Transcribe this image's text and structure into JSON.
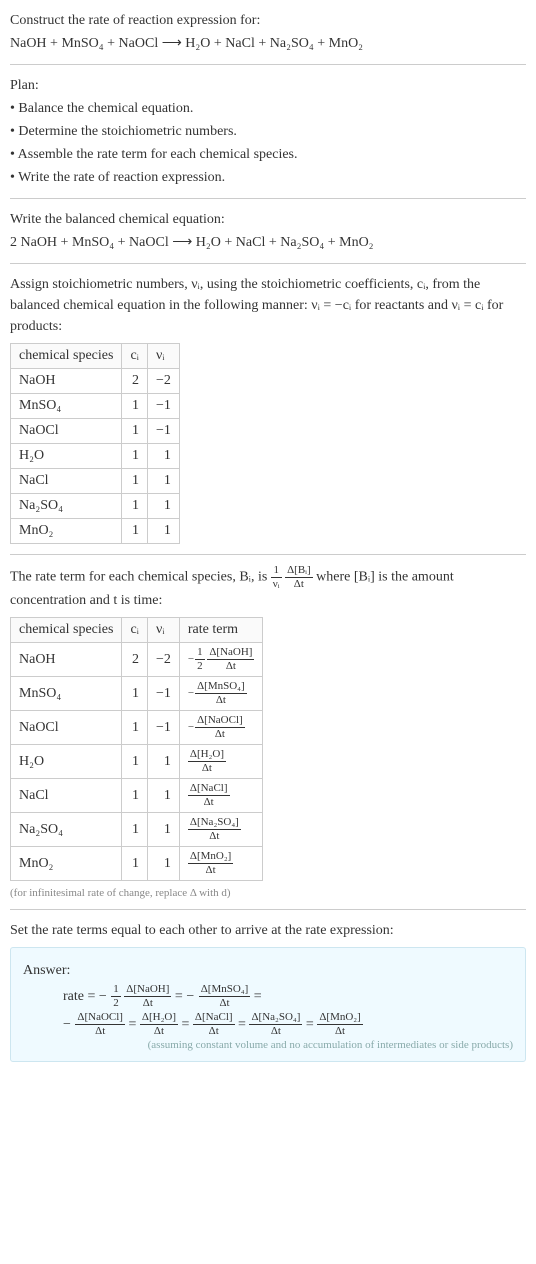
{
  "header": {
    "title": "Construct the rate of reaction expression for:",
    "equation": "NaOH + MnSO₄ + NaOCl ⟶ H₂O + NaCl + Na₂SO₄ + MnO₂"
  },
  "plan": {
    "title": "Plan:",
    "items": [
      "• Balance the chemical equation.",
      "• Determine the stoichiometric numbers.",
      "• Assemble the rate term for each chemical species.",
      "• Write the rate of reaction expression."
    ]
  },
  "balanced": {
    "title": "Write the balanced chemical equation:",
    "equation": "2 NaOH + MnSO₄ + NaOCl ⟶ H₂O + NaCl + Na₂SO₄ + MnO₂"
  },
  "stoich": {
    "text1": "Assign stoichiometric numbers, νᵢ, using the stoichiometric coefficients, cᵢ, from the balanced chemical equation in the following manner: νᵢ = −cᵢ for reactants and νᵢ = cᵢ for products:",
    "headers": {
      "species": "chemical species",
      "c": "cᵢ",
      "v": "νᵢ"
    },
    "rows": [
      {
        "species": "NaOH",
        "c": "2",
        "v": "−2"
      },
      {
        "species": "MnSO₄",
        "c": "1",
        "v": "−1"
      },
      {
        "species": "NaOCl",
        "c": "1",
        "v": "−1"
      },
      {
        "species": "H₂O",
        "c": "1",
        "v": "1"
      },
      {
        "species": "NaCl",
        "c": "1",
        "v": "1"
      },
      {
        "species": "Na₂SO₄",
        "c": "1",
        "v": "1"
      },
      {
        "species": "MnO₂",
        "c": "1",
        "v": "1"
      }
    ]
  },
  "rate_intro": {
    "part1": "The rate term for each chemical species, Bᵢ, is ",
    "frac1_top": "1",
    "frac1_bot": "νᵢ",
    "frac2_top": "Δ[Bᵢ]",
    "frac2_bot": "Δt",
    "part2": " where [Bᵢ] is the amount concentration and t is time:"
  },
  "rate_table": {
    "headers": {
      "species": "chemical species",
      "c": "cᵢ",
      "v": "νᵢ",
      "rate": "rate term"
    },
    "rows": [
      {
        "species": "NaOH",
        "c": "2",
        "v": "−2",
        "neg": "−",
        "coef_top": "1",
        "coef_bot": "2",
        "num": "Δ[NaOH]",
        "den": "Δt"
      },
      {
        "species": "MnSO₄",
        "c": "1",
        "v": "−1",
        "neg": "−",
        "coef_top": "",
        "coef_bot": "",
        "num": "Δ[MnSO₄]",
        "den": "Δt"
      },
      {
        "species": "NaOCl",
        "c": "1",
        "v": "−1",
        "neg": "−",
        "coef_top": "",
        "coef_bot": "",
        "num": "Δ[NaOCl]",
        "den": "Δt"
      },
      {
        "species": "H₂O",
        "c": "1",
        "v": "1",
        "neg": "",
        "coef_top": "",
        "coef_bot": "",
        "num": "Δ[H₂O]",
        "den": "Δt"
      },
      {
        "species": "NaCl",
        "c": "1",
        "v": "1",
        "neg": "",
        "coef_top": "",
        "coef_bot": "",
        "num": "Δ[NaCl]",
        "den": "Δt"
      },
      {
        "species": "Na₂SO₄",
        "c": "1",
        "v": "1",
        "neg": "",
        "coef_top": "",
        "coef_bot": "",
        "num": "Δ[Na₂SO₄]",
        "den": "Δt"
      },
      {
        "species": "MnO₂",
        "c": "1",
        "v": "1",
        "neg": "",
        "coef_top": "",
        "coef_bot": "",
        "num": "Δ[MnO₂]",
        "den": "Δt"
      }
    ],
    "footnote": "(for infinitesimal rate of change, replace Δ with d)"
  },
  "final": {
    "intro": "Set the rate terms equal to each other to arrive at the rate expression:"
  },
  "answer": {
    "label": "Answer:",
    "rate_label": "rate = ",
    "terms": {
      "neg1": "−",
      "coef1_top": "1",
      "coef1_bot": "2",
      "num1": "Δ[NaOH]",
      "den": "Δt",
      "neg2": "−",
      "num2": "Δ[MnSO₄]",
      "neg3": "−",
      "num3": "Δ[NaOCl]",
      "num4": "Δ[H₂O]",
      "num5": "Δ[NaCl]",
      "num6": "Δ[Na₂SO₄]",
      "num7": "Δ[MnO₂]",
      "eq": " = "
    },
    "footnote": "(assuming constant volume and no accumulation of intermediates or side products)"
  },
  "chart_data": {
    "type": "table",
    "title": "Stoichiometric numbers and rate terms",
    "tables": [
      {
        "columns": [
          "chemical species",
          "cᵢ",
          "νᵢ"
        ],
        "rows": [
          [
            "NaOH",
            2,
            -2
          ],
          [
            "MnSO₄",
            1,
            -1
          ],
          [
            "NaOCl",
            1,
            -1
          ],
          [
            "H₂O",
            1,
            1
          ],
          [
            "NaCl",
            1,
            1
          ],
          [
            "Na₂SO₄",
            1,
            1
          ],
          [
            "MnO₂",
            1,
            1
          ]
        ]
      },
      {
        "columns": [
          "chemical species",
          "cᵢ",
          "νᵢ",
          "rate term"
        ],
        "rows": [
          [
            "NaOH",
            2,
            -2,
            "−(1/2) Δ[NaOH]/Δt"
          ],
          [
            "MnSO₄",
            1,
            -1,
            "−Δ[MnSO₄]/Δt"
          ],
          [
            "NaOCl",
            1,
            -1,
            "−Δ[NaOCl]/Δt"
          ],
          [
            "H₂O",
            1,
            1,
            "Δ[H₂O]/Δt"
          ],
          [
            "NaCl",
            1,
            1,
            "Δ[NaCl]/Δt"
          ],
          [
            "Na₂SO₄",
            1,
            1,
            "Δ[Na₂SO₄]/Δt"
          ],
          [
            "MnO₂",
            1,
            1,
            "Δ[MnO₂]/Δt"
          ]
        ]
      }
    ]
  }
}
